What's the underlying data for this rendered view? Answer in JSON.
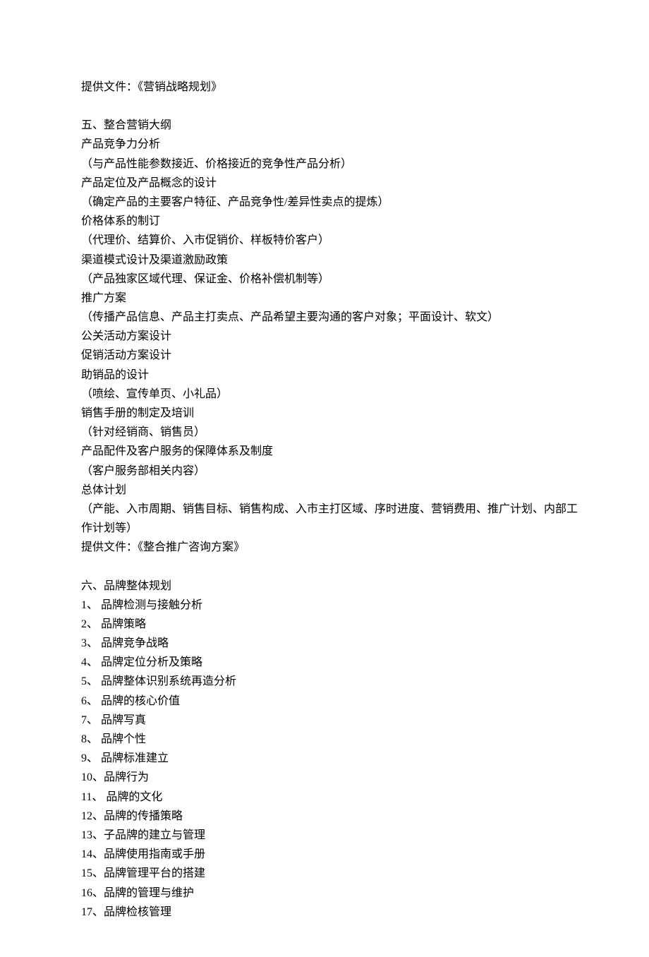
{
  "lines": [
    "提供文件：《营销战略规划》",
    "",
    "五、整合营销大纲",
    "产品竞争力分析",
    "（与产品性能参数接近、价格接近的竞争性产品分析）",
    "产品定位及产品概念的设计",
    "（确定产品的主要客户特征、产品竞争性/差异性卖点的提炼）",
    "价格体系的制订",
    "（代理价、结算价、入市促销价、样板特价客户）",
    "渠道模式设计及渠道激励政策",
    "（产品独家区域代理、保证金、价格补偿机制等）",
    "推广方案",
    "（传播产品信息、产品主打卖点、产品希望主要沟通的客户对象；平面设计、软文）",
    "公关活动方案设计",
    "促销活动方案设计",
    "助销品的设计",
    "（喷绘、宣传单页、小礼品）",
    "销售手册的制定及培训",
    "（针对经销商、销售员）",
    "产品配件及客户服务的保障体系及制度",
    "（客户服务部相关内容）",
    "总体计划",
    "（产能、入市周期、销售目标、销售构成、入市主打区域、序时进度、营销费用、推广计划、内部工",
    "作计划等）",
    "提供文件：《整合推广咨询方案》",
    "",
    "六、品牌整体规划",
    "1、 品牌检测与接触分析",
    "2、 品牌策略",
    "3、 品牌竞争战略",
    "4、 品牌定位分析及策略",
    "5、 品牌整体识别系统再造分析",
    "6、 品牌的核心价值",
    "7、 品牌写真",
    "8、 品牌个性",
    "9、 品牌标准建立",
    "10、品牌行为",
    "11、      品牌的文化",
    "12、品牌的传播策略",
    "13、子品牌的建立与管理",
    "14、品牌使用指南或手册",
    "15、品牌管理平台的搭建",
    "16、品牌的管理与维护",
    "17、品牌检核管理"
  ]
}
